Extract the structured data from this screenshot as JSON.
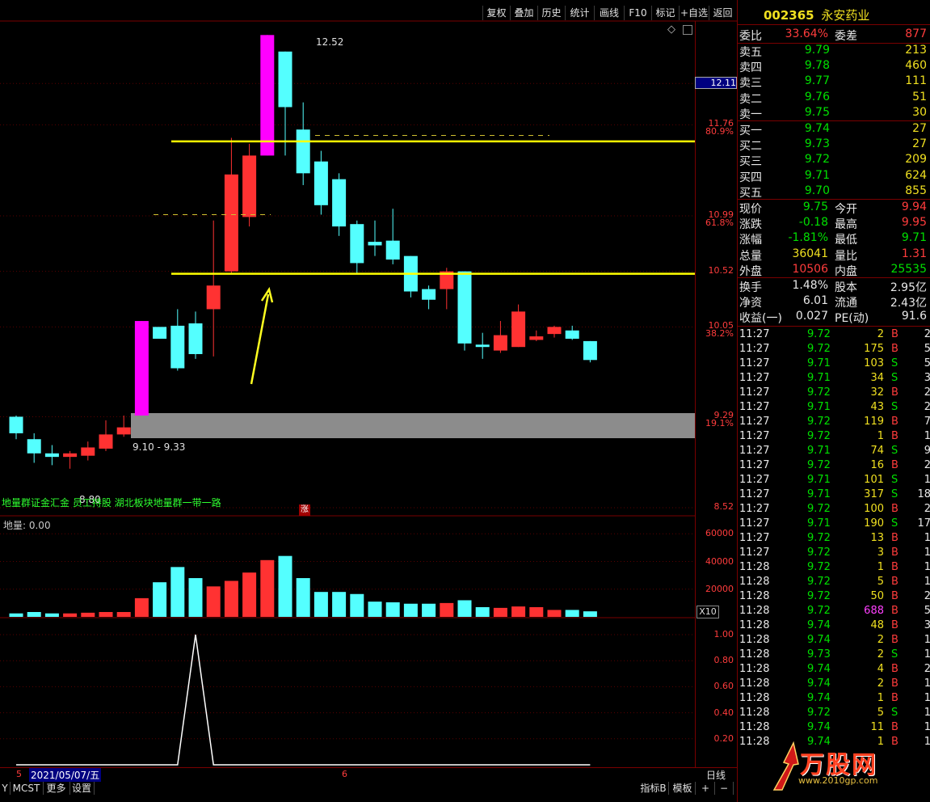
{
  "toolbar": {
    "buttons": [
      "复权",
      "叠加",
      "历史",
      "统计",
      "画线",
      "F10",
      "标记",
      "+自选",
      "返回"
    ]
  },
  "chart": {
    "price_labels": [
      {
        "value": "12.11",
        "boxed": true
      },
      {
        "value": "11.76",
        "pct": "80.9%"
      },
      {
        "value": "10.99",
        "pct": "61.8%"
      },
      {
        "value": "10.52"
      },
      {
        "value": "10.05",
        "pct": "38.2%"
      },
      {
        "value": "9.29",
        "pct": "19.1%"
      },
      {
        "value": "8.52"
      }
    ],
    "high_label": "12.52",
    "range_label": "9.10 - 9.33",
    "low_label": "8.80",
    "news_ticker": "地量群证金汇金 员工持股 湖北板块地量群一带一路",
    "zhang_badge": "涨",
    "diamond": "◇",
    "volume_title": "地量: 0.00",
    "volume_labels": [
      "60000",
      "40000",
      "20000"
    ],
    "x10_label": "X10",
    "indicator_labels": [
      "1.00",
      "0.80",
      "0.60",
      "0.40",
      "0.20"
    ],
    "date_bar": {
      "left": "5",
      "date": "2021/05/07/五",
      "mid": "6",
      "right": "日线"
    }
  },
  "chart_data": {
    "type": "candlestick",
    "candles": [
      {
        "o": 9.29,
        "c": 9.15,
        "h": 9.3,
        "l": 9.1
      },
      {
        "o": 9.1,
        "c": 8.98,
        "h": 9.15,
        "l": 8.9
      },
      {
        "o": 8.98,
        "c": 8.95,
        "h": 9.05,
        "l": 8.88
      },
      {
        "o": 8.95,
        "c": 8.98,
        "h": 9.0,
        "l": 8.85
      },
      {
        "o": 8.96,
        "c": 9.03,
        "h": 9.08,
        "l": 8.92
      },
      {
        "o": 9.02,
        "c": 9.14,
        "h": 9.26,
        "l": 9.0
      },
      {
        "o": 9.14,
        "c": 9.2,
        "h": 9.3,
        "l": 9.12
      },
      {
        "o": 9.3,
        "c": 10.1,
        "h": 10.1,
        "l": 9.3,
        "color": "magenta"
      },
      {
        "o": 10.05,
        "c": 9.95,
        "h": 10.0,
        "l": 9.95
      },
      {
        "o": 10.06,
        "c": 9.7,
        "h": 10.2,
        "l": 9.68
      },
      {
        "o": 10.08,
        "c": 9.82,
        "h": 10.18,
        "l": 9.78
      },
      {
        "o": 10.2,
        "c": 10.4,
        "h": 10.95,
        "l": 9.8
      },
      {
        "o": 10.52,
        "c": 11.34,
        "h": 11.65,
        "l": 10.5
      },
      {
        "o": 10.98,
        "c": 11.5,
        "h": 11.6,
        "l": 10.9
      },
      {
        "o": 11.5,
        "c": 12.52,
        "h": 12.52,
        "l": 11.5,
        "color": "magenta"
      },
      {
        "o": 12.38,
        "c": 11.91,
        "h": 12.38,
        "l": 11.5
      },
      {
        "o": 11.72,
        "c": 11.35,
        "h": 11.95,
        "l": 11.25
      },
      {
        "o": 11.45,
        "c": 11.08,
        "h": 11.54,
        "l": 11.0
      },
      {
        "o": 11.3,
        "c": 10.9,
        "h": 11.35,
        "l": 10.82
      },
      {
        "o": 10.92,
        "c": 10.59,
        "h": 10.95,
        "l": 10.5
      },
      {
        "o": 10.77,
        "c": 10.74,
        "h": 10.95,
        "l": 10.65
      },
      {
        "o": 10.78,
        "c": 10.62,
        "h": 11.05,
        "l": 10.58
      },
      {
        "o": 10.65,
        "c": 10.35,
        "h": 10.65,
        "l": 10.3
      },
      {
        "o": 10.37,
        "c": 10.28,
        "h": 10.4,
        "l": 10.2
      },
      {
        "o": 10.37,
        "c": 10.52,
        "h": 10.55,
        "l": 10.2
      },
      {
        "o": 10.52,
        "c": 9.91,
        "h": 10.52,
        "l": 9.85
      },
      {
        "o": 9.9,
        "c": 9.88,
        "h": 10.0,
        "l": 9.78
      },
      {
        "o": 9.85,
        "c": 9.98,
        "h": 10.1,
        "l": 9.83
      },
      {
        "o": 9.88,
        "c": 10.18,
        "h": 10.24,
        "l": 9.88
      },
      {
        "o": 9.94,
        "c": 9.97,
        "h": 10.02,
        "l": 9.93
      },
      {
        "o": 9.99,
        "c": 10.05,
        "h": 10.06,
        "l": 9.96
      },
      {
        "o": 10.02,
        "c": 9.95,
        "h": 10.06,
        "l": 9.94
      },
      {
        "o": 9.93,
        "c": 9.77,
        "h": 9.93,
        "l": 9.75
      }
    ],
    "volumes": [
      2500,
      3500,
      2500,
      2500,
      3000,
      3500,
      3500,
      13500,
      25000,
      36000,
      28000,
      22000,
      26000,
      32000,
      41000,
      44000,
      28000,
      18000,
      18000,
      16500,
      11000,
      10500,
      9500,
      9500,
      10000,
      12000,
      7000,
      6500,
      7500,
      7000,
      5000,
      5000,
      4000
    ],
    "indicator": [
      0,
      0,
      0,
      0,
      0,
      0,
      0,
      0,
      0,
      0,
      1,
      0,
      0,
      0,
      0,
      0,
      0,
      0,
      0,
      0,
      0,
      0,
      0,
      0,
      0,
      0,
      0,
      0,
      0,
      0,
      0,
      0,
      0
    ],
    "ylim": [
      8.52,
      12.7
    ]
  },
  "stock": {
    "code": "002365",
    "name": "永安药业"
  },
  "weibi": {
    "label": "委比",
    "value": "33.64%",
    "label2": "委差",
    "value2": "877"
  },
  "asks": [
    {
      "label": "卖五",
      "price": "9.79",
      "vol": "213"
    },
    {
      "label": "卖四",
      "price": "9.78",
      "vol": "460"
    },
    {
      "label": "卖三",
      "price": "9.77",
      "vol": "111"
    },
    {
      "label": "卖二",
      "price": "9.76",
      "vol": "51"
    },
    {
      "label": "卖一",
      "price": "9.75",
      "vol": "30"
    }
  ],
  "bids": [
    {
      "label": "买一",
      "price": "9.74",
      "vol": "27"
    },
    {
      "label": "买二",
      "price": "9.73",
      "vol": "27"
    },
    {
      "label": "买三",
      "price": "9.72",
      "vol": "209"
    },
    {
      "label": "买四",
      "price": "9.71",
      "vol": "624"
    },
    {
      "label": "买五",
      "price": "9.70",
      "vol": "855"
    }
  ],
  "stats": [
    {
      "l1": "现价",
      "v1": "9.75",
      "c1": "green",
      "l2": "今开",
      "v2": "9.94",
      "c2": "red"
    },
    {
      "l1": "涨跌",
      "v1": "-0.18",
      "c1": "green",
      "l2": "最高",
      "v2": "9.95",
      "c2": "red"
    },
    {
      "l1": "涨幅",
      "v1": "-1.81%",
      "c1": "green",
      "l2": "最低",
      "v2": "9.71",
      "c2": "green"
    },
    {
      "l1": "总量",
      "v1": "36041",
      "c1": "yel",
      "l2": "量比",
      "v2": "1.31",
      "c2": "red"
    },
    {
      "l1": "外盘",
      "v1": "10506",
      "c1": "red",
      "l2": "内盘",
      "v2": "25535",
      "c2": "green"
    }
  ],
  "stats2": [
    {
      "l1": "换手",
      "v1": "1.48%",
      "l2": "股本",
      "v2": "2.95亿"
    },
    {
      "l1": "净资",
      "v1": "6.01",
      "l2": "流通",
      "v2": "2.43亿"
    },
    {
      "l1": "收益(一)",
      "v1": "0.027",
      "l2": "PE(动)",
      "v2": "91.6"
    }
  ],
  "ticks": [
    {
      "t": "11:27",
      "p": "9.72",
      "pc": "green",
      "v": "2",
      "vc": "yel",
      "bs": "B",
      "n": "2"
    },
    {
      "t": "11:27",
      "p": "9.72",
      "pc": "green",
      "v": "175",
      "vc": "yel",
      "bs": "B",
      "n": "5"
    },
    {
      "t": "11:27",
      "p": "9.71",
      "pc": "green",
      "v": "103",
      "vc": "yel",
      "bs": "S",
      "n": "5"
    },
    {
      "t": "11:27",
      "p": "9.71",
      "pc": "green",
      "v": "34",
      "vc": "yel",
      "bs": "S",
      "n": "3"
    },
    {
      "t": "11:27",
      "p": "9.72",
      "pc": "green",
      "v": "32",
      "vc": "yel",
      "bs": "B",
      "n": "2"
    },
    {
      "t": "11:27",
      "p": "9.71",
      "pc": "green",
      "v": "43",
      "vc": "yel",
      "bs": "S",
      "n": "2"
    },
    {
      "t": "11:27",
      "p": "9.72",
      "pc": "green",
      "v": "119",
      "vc": "yel",
      "bs": "B",
      "n": "7"
    },
    {
      "t": "11:27",
      "p": "9.72",
      "pc": "green",
      "v": "1",
      "vc": "yel",
      "bs": "B",
      "n": "1"
    },
    {
      "t": "11:27",
      "p": "9.71",
      "pc": "green",
      "v": "74",
      "vc": "yel",
      "bs": "S",
      "n": "9"
    },
    {
      "t": "11:27",
      "p": "9.72",
      "pc": "green",
      "v": "16",
      "vc": "yel",
      "bs": "B",
      "n": "2"
    },
    {
      "t": "11:27",
      "p": "9.71",
      "pc": "green",
      "v": "101",
      "vc": "yel",
      "bs": "S",
      "n": "1"
    },
    {
      "t": "11:27",
      "p": "9.71",
      "pc": "green",
      "v": "317",
      "vc": "yel",
      "bs": "S",
      "n": "18"
    },
    {
      "t": "11:27",
      "p": "9.72",
      "pc": "green",
      "v": "100",
      "vc": "yel",
      "bs": "B",
      "n": "2"
    },
    {
      "t": "11:27",
      "p": "9.71",
      "pc": "green",
      "v": "190",
      "vc": "yel",
      "bs": "S",
      "n": "17"
    },
    {
      "t": "11:27",
      "p": "9.72",
      "pc": "green",
      "v": "13",
      "vc": "yel",
      "bs": "B",
      "n": "1"
    },
    {
      "t": "11:27",
      "p": "9.72",
      "pc": "green",
      "v": "3",
      "vc": "yel",
      "bs": "B",
      "n": "1"
    },
    {
      "t": "11:28",
      "p": "9.72",
      "pc": "green",
      "v": "1",
      "vc": "yel",
      "bs": "B",
      "n": "1"
    },
    {
      "t": "11:28",
      "p": "9.72",
      "pc": "green",
      "v": "5",
      "vc": "yel",
      "bs": "B",
      "n": "1"
    },
    {
      "t": "11:28",
      "p": "9.72",
      "pc": "green",
      "v": "50",
      "vc": "yel",
      "bs": "B",
      "n": "2"
    },
    {
      "t": "11:28",
      "p": "9.72",
      "pc": "green",
      "v": "688",
      "vc": "pur",
      "bs": "B",
      "n": "5"
    },
    {
      "t": "11:28",
      "p": "9.74",
      "pc": "green",
      "v": "48",
      "vc": "yel",
      "bs": "B",
      "n": "3"
    },
    {
      "t": "11:28",
      "p": "9.74",
      "pc": "green",
      "v": "2",
      "vc": "yel",
      "bs": "B",
      "n": "1"
    },
    {
      "t": "11:28",
      "p": "9.73",
      "pc": "green",
      "v": "2",
      "vc": "yel",
      "bs": "S",
      "n": "1"
    },
    {
      "t": "11:28",
      "p": "9.74",
      "pc": "green",
      "v": "4",
      "vc": "yel",
      "bs": "B",
      "n": "2"
    },
    {
      "t": "11:28",
      "p": "9.74",
      "pc": "green",
      "v": "2",
      "vc": "yel",
      "bs": "B",
      "n": "1"
    },
    {
      "t": "11:28",
      "p": "9.74",
      "pc": "green",
      "v": "1",
      "vc": "yel",
      "bs": "B",
      "n": "1"
    },
    {
      "t": "11:28",
      "p": "9.72",
      "pc": "green",
      "v": "5",
      "vc": "yel",
      "bs": "S",
      "n": "1"
    },
    {
      "t": "11:28",
      "p": "9.74",
      "pc": "green",
      "v": "11",
      "vc": "yel",
      "bs": "B",
      "n": "1"
    },
    {
      "t": "11:28",
      "p": "9.74",
      "pc": "green",
      "v": "1",
      "vc": "yel",
      "bs": "B",
      "n": "1"
    }
  ],
  "bottom_bar": {
    "buttons": [
      "Y",
      "MCST",
      "更多",
      "设置"
    ],
    "right_buttons": [
      "指标B",
      "模板",
      "+",
      "−"
    ]
  },
  "watermark": {
    "brand": "万股网",
    "url": "www.2010gp.com"
  }
}
